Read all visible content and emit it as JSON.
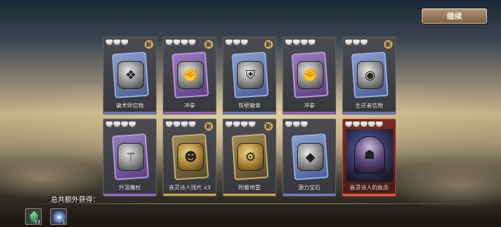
{
  "continue_label": "继续",
  "new_badge": "新",
  "cards": [
    {
      "label": "骗术师信物",
      "stars": 3,
      "is_new": true,
      "frame": "blue",
      "icon": "ornate-book-icon"
    },
    {
      "label": "冲拳",
      "stars": 4,
      "is_new": true,
      "frame": "purple",
      "icon": "gauntlet-icon"
    },
    {
      "label": "铁壁徽章",
      "stars": 3,
      "is_new": true,
      "frame": "blue",
      "icon": "shield-emblem-icon"
    },
    {
      "label": "冲拳",
      "stars": 4,
      "is_new": false,
      "frame": "purple",
      "icon": "gauntlet-icon"
    },
    {
      "label": "生还者信物",
      "stars": 3,
      "is_new": true,
      "frame": "blue",
      "icon": "eye-amulet-icon"
    },
    {
      "label": "升温魔杖",
      "stars": 4,
      "is_new": false,
      "frame": "purple",
      "icon": "wand-icon"
    },
    {
      "label": "音灵诗人残片 x3",
      "stars": 4,
      "is_new": true,
      "frame": "gold",
      "icon": "character-shard-icon"
    },
    {
      "label": "附着地雷",
      "stars": 4,
      "is_new": true,
      "frame": "gold",
      "icon": "mine-icon"
    },
    {
      "label": "源力宝石",
      "stars": 3,
      "is_new": false,
      "frame": "blue",
      "icon": "crystal-gem-icon"
    },
    {
      "label": "音灵诗人的执念",
      "stars": 5,
      "is_new": false,
      "frame": "red",
      "icon": "character-portrait-icon"
    }
  ],
  "extra_label": "总共额外获得：",
  "extras": [
    {
      "count": "53",
      "icon": "green-gem-icon"
    },
    {
      "count": "1",
      "icon": "blue-rune-icon"
    }
  ]
}
